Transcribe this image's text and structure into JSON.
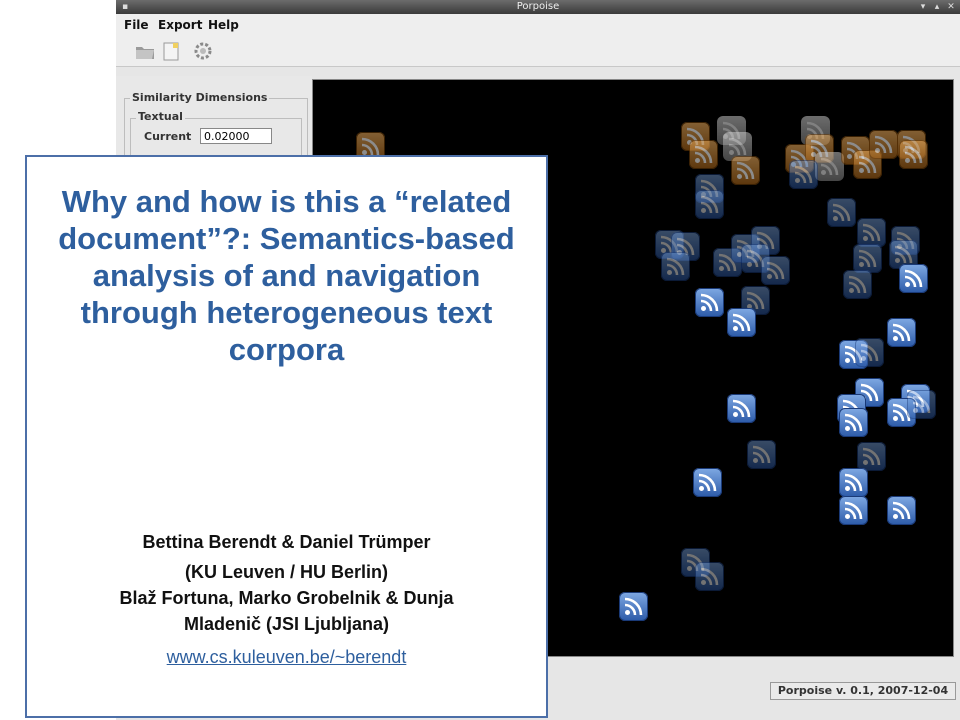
{
  "window": {
    "title": "Porpoise"
  },
  "menu": {
    "file": "File",
    "export": "Export",
    "help": "Help"
  },
  "toolbar": {
    "items": [
      "open-icon",
      "new-document-icon",
      "settings-icon"
    ]
  },
  "left_panel": {
    "group_title": "Similarity Dimensions",
    "subgroup_title": "Textual",
    "current_label": "Current",
    "current_value": "0.02000"
  },
  "status": {
    "version": "Porpoise v. 0.1, 2007-12-04"
  },
  "overlay": {
    "title": "Why and how is this a “related document”?: Semantics-based analysis of and navigation through heterogeneous text corpora",
    "authors_line1": "Bettina Berendt & Daniel Trümper",
    "authors_line2": "(KU Leuven / HU Berlin)",
    "authors_line3": "Blaž Fortuna, Marko Grobelnik & Dunja",
    "authors_line4": "Mladenič (JSI Ljubljana)",
    "link": "www.cs.kuleuven.be/~berendt"
  },
  "colors": {
    "title_blue": "#2e5f9e",
    "canvas": "#000000",
    "rss_blue": "#3b6cc0",
    "overlay_border": "#4c6fa8"
  }
}
